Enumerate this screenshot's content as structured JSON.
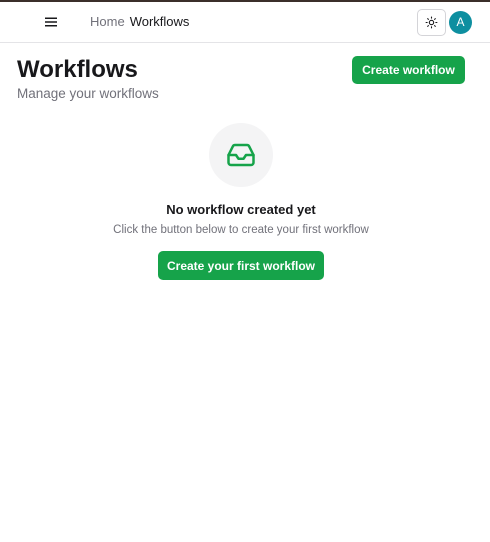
{
  "header": {
    "breadcrumb": {
      "home": "Home",
      "current": "Workflows"
    },
    "avatar_initial": "A",
    "icons": {
      "menu": "hamburger-menu-icon",
      "theme": "sun-icon"
    }
  },
  "page": {
    "title": "Workflows",
    "subtitle": "Manage your workflows",
    "create_button": "Create workflow"
  },
  "empty_state": {
    "icon": "inbox-icon",
    "title": "No workflow created yet",
    "description": "Click the button below to create your first workflow",
    "button": "Create your first workflow"
  },
  "colors": {
    "accent": "#16a34a",
    "avatar": "#0e8fa0",
    "muted_text": "#71717a",
    "border": "#e4e4e7"
  }
}
